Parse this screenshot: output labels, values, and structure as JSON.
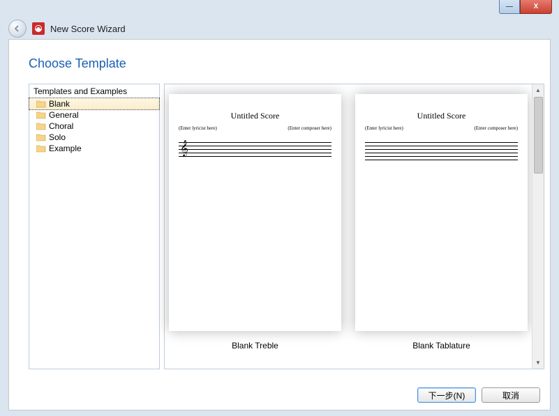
{
  "window": {
    "title": "New Score Wizard"
  },
  "heading": "Choose Template",
  "tree": {
    "header": "Templates and Examples",
    "items": [
      {
        "label": "Blank",
        "selected": true
      },
      {
        "label": "General",
        "selected": false
      },
      {
        "label": "Choral",
        "selected": false
      },
      {
        "label": "Solo",
        "selected": false
      },
      {
        "label": "Example",
        "selected": false
      }
    ]
  },
  "templates": [
    {
      "name": "Blank Treble",
      "score_title": "Untitled Score",
      "lyricist_placeholder": "(Enter lyricist here)",
      "composer_placeholder": "(Enter composer here)",
      "staff_lines": 5
    },
    {
      "name": "Blank Tablature",
      "score_title": "Untitled Score",
      "lyricist_placeholder": "(Enter lyricist here)",
      "composer_placeholder": "(Enter composer here)",
      "staff_lines": 6
    }
  ],
  "buttons": {
    "next": "下一步(N)",
    "cancel": "取消"
  },
  "titlebar": {
    "minimize": "—",
    "close": "X"
  }
}
